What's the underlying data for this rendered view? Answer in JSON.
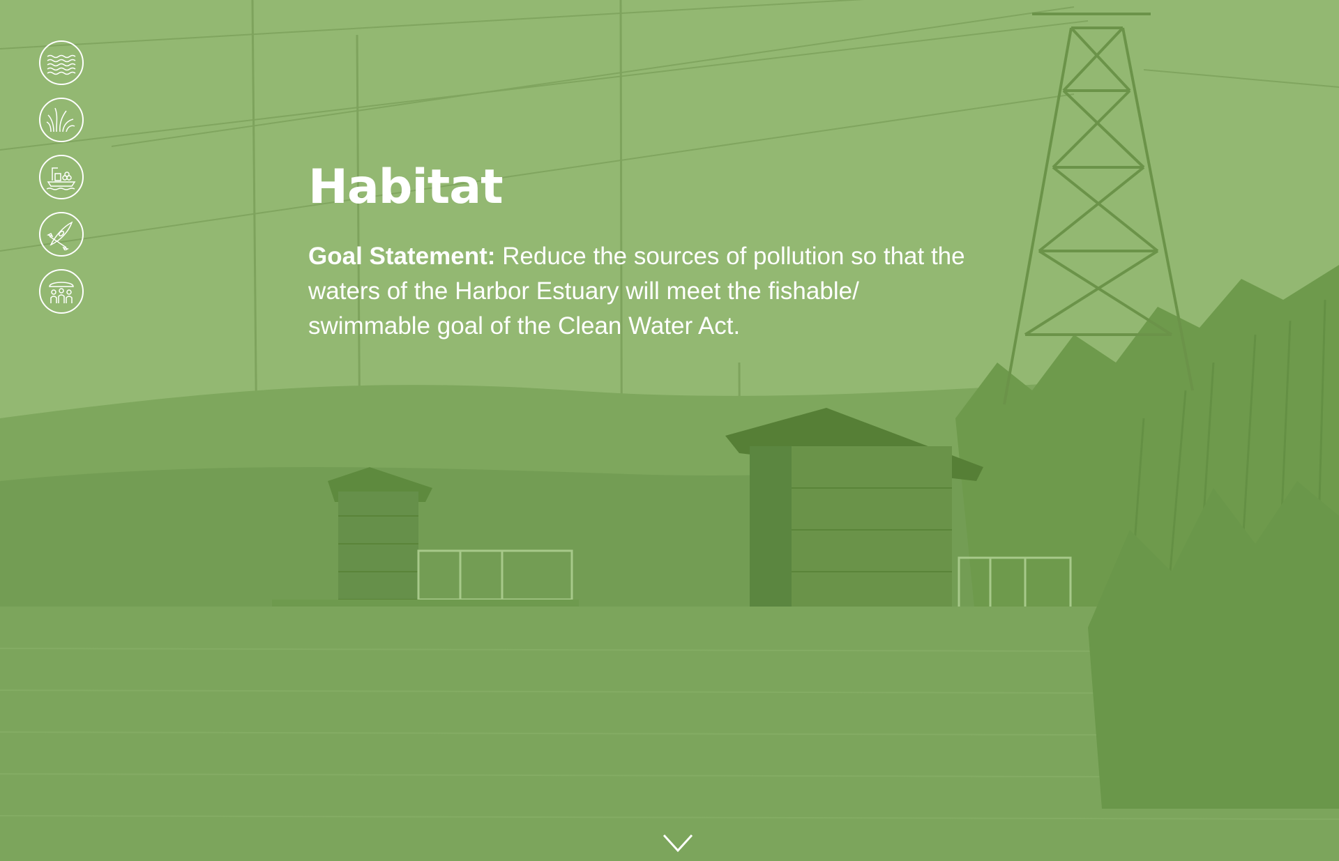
{
  "section": {
    "title": "Habitat",
    "goal_label": "Goal Statement:",
    "goal_text": "Reduce the sources of pollution so that the waters of the Harbor Estuary will meet the fishable/ swimmable goal of the Clean Water Act."
  },
  "nav": {
    "items": [
      {
        "icon": "water-waves-icon"
      },
      {
        "icon": "grass-icon"
      },
      {
        "icon": "port-industry-icon"
      },
      {
        "icon": "kayak-paddle-icon"
      },
      {
        "icon": "community-people-icon"
      }
    ]
  },
  "scroll": {
    "icon": "chevron-down-icon"
  },
  "colors": {
    "overlay_green": "#8fb56d",
    "dark_green": "#5e8a3e",
    "text": "#ffffff"
  }
}
